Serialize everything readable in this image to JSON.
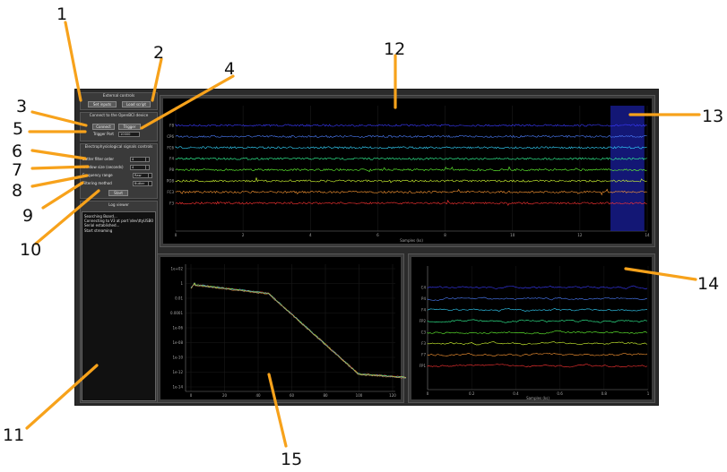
{
  "colors": {
    "accent": "#f7a21b",
    "highlight": "#1a1f9c",
    "plot_bg": "#000000"
  },
  "external_controls": {
    "title": "External controls",
    "buttons": [
      "Set inputs",
      "Load script"
    ]
  },
  "device": {
    "title": "Connect to the OpenBCI device",
    "connect": "Connect",
    "trigger": "Trigger",
    "trigger_port_label": "Trigger Port",
    "trigger_port_value": "10000"
  },
  "electro": {
    "title": "Electrophysiological signals controls",
    "butter_label": "Butter filter order",
    "butter_value": "4",
    "window_label": "Window size (seconds)",
    "window_value": "4",
    "freq_label": "Frequency range",
    "freq_value": "Raw",
    "filter_label": "Filtering method",
    "filter_value": "Butter",
    "start": "Start"
  },
  "log": {
    "title": "Log viewer",
    "lines": [
      "Searching Board...",
      "Connecting to V3 at port \\dev\\ttyUSB0",
      "Serial established...",
      "Start streaming"
    ]
  },
  "time_plot": {
    "channels": [
      "F8",
      "CP6",
      "FC6",
      "F4",
      "P8",
      "PO8",
      "FC3",
      "F3"
    ],
    "colors": [
      "#3a3aff",
      "#4d7fff",
      "#33d6ff",
      "#33ff99",
      "#66ff33",
      "#d6ff33",
      "#ff9933",
      "#ff3333"
    ],
    "x_ticks": [
      "0",
      "2",
      "4",
      "6",
      "8",
      "10",
      "12",
      "14"
    ],
    "x_label": "Samples (ks)"
  },
  "psd_plot": {
    "y_ticks": [
      "1e+02",
      "1",
      "0.01",
      "0.0001",
      "1e-06",
      "1e-08",
      "1e-10",
      "1e-12",
      "1e-14"
    ],
    "x_ticks": [
      "0",
      "20",
      "40",
      "60",
      "80",
      "100",
      "120"
    ]
  },
  "small_plot": {
    "channels": [
      "C4",
      "P4",
      "F4",
      "FP2",
      "C3",
      "F3",
      "F7",
      "FP1"
    ],
    "colors": [
      "#3a3aff",
      "#4d7fff",
      "#33d6ff",
      "#33ff99",
      "#66ff33",
      "#d6ff33",
      "#ff9933",
      "#ff3333"
    ],
    "x_ticks": [
      "0",
      "0.2",
      "0.4",
      "0.6",
      "0.8",
      "1"
    ],
    "x_label": "Samples (ks)"
  },
  "annotations": [
    "1",
    "2",
    "3",
    "4",
    "5",
    "6",
    "7",
    "8",
    "9",
    "10",
    "11",
    "12",
    "13",
    "14",
    "15"
  ]
}
